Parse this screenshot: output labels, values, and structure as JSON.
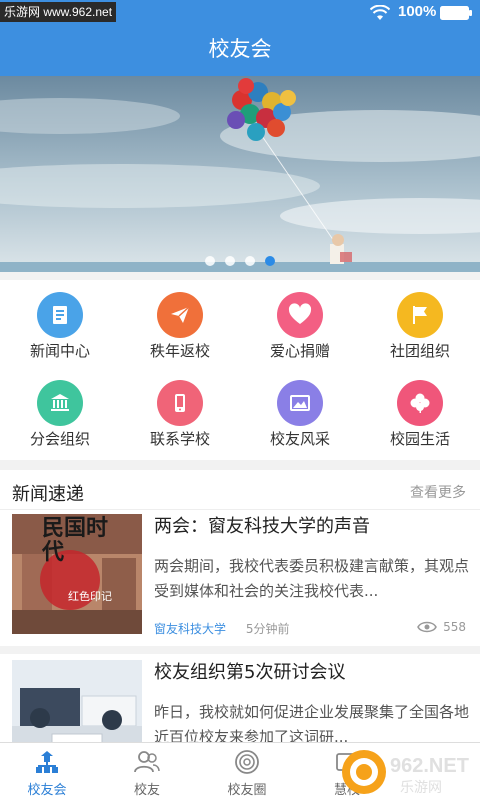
{
  "status_bar": {
    "watermark": "乐游网 www.962.net",
    "battery": "100%"
  },
  "header": {
    "title": "校友会"
  },
  "banner": {
    "dots": 4,
    "active_dot": 4
  },
  "grid": [
    {
      "label": "新闻中心",
      "icon": "news-doc-icon",
      "color": "#4aa3e8"
    },
    {
      "label": "秩年返校",
      "icon": "paper-plane-icon",
      "color": "#f0703a"
    },
    {
      "label": "爱心捐赠",
      "icon": "heart-icon",
      "color": "#f35f83"
    },
    {
      "label": "社团组织",
      "icon": "flag-icon",
      "color": "#f5b820"
    },
    {
      "label": "分会组织",
      "icon": "institution-icon",
      "color": "#3fc59d"
    },
    {
      "label": "联系学校",
      "icon": "phone-icon",
      "color": "#f06478"
    },
    {
      "label": "校友风采",
      "icon": "picture-icon",
      "color": "#8a7fe6"
    },
    {
      "label": "校园生活",
      "icon": "clover-icon",
      "color": "#f0567a"
    }
  ],
  "news": {
    "title": "新闻速递",
    "more": "查看更多",
    "articles": [
      {
        "title": "两会：窗友科技大学的声音",
        "summary": "两会期间，我校代表委员积极建言献策，其观点受到媒体和社会的关注我校代表...",
        "source": "窗友科技大学",
        "time": "5分钟前",
        "views": "558",
        "thumb_text": "民国时代",
        "thumb_sub": "红色印记"
      },
      {
        "title": "校友组织第5次研讨会议",
        "summary": "昨日，我校就如何促进企业发展聚集了全国各地近百位校友来参加了这词研..."
      }
    ]
  },
  "tabbar": [
    {
      "label": "校友会",
      "icon": "home-sitemap-icon",
      "active": true
    },
    {
      "label": "校友",
      "icon": "contacts-icon",
      "active": false
    },
    {
      "label": "校友圈",
      "icon": "circle-target-icon",
      "active": false
    },
    {
      "label": "慧校",
      "icon": "smart-school-icon",
      "active": false
    }
  ],
  "corner_logo": "962.NET 乐游网"
}
